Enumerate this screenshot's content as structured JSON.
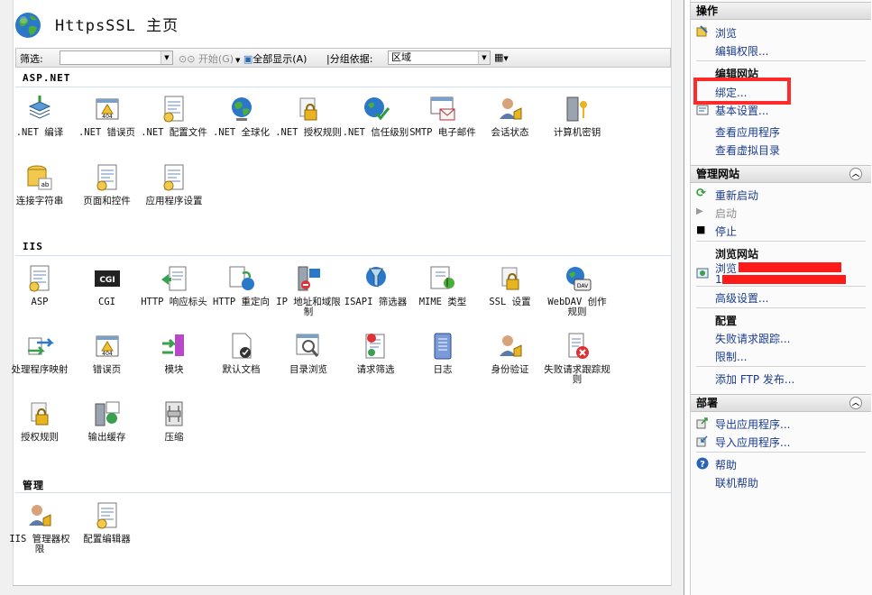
{
  "page": {
    "title": "HttpsSSL 主页"
  },
  "filterbar": {
    "filter_label": "筛选:",
    "start_label": "开始(G)",
    "show_all_label": "全部显示(A)",
    "group_label": "|分组依据:",
    "group_value": "区域"
  },
  "sections": {
    "aspnet": "ASP.NET",
    "iis": "IIS",
    "manage": "管理"
  },
  "features": {
    "aspnet": [
      {
        "label": ".NET 编译",
        "icon": "compile-icon"
      },
      {
        "label": ".NET 错误页",
        "icon": "error-page-icon"
      },
      {
        "label": ".NET 配置文件",
        "icon": "profile-icon"
      },
      {
        "label": ".NET 全球化",
        "icon": "globe-icon"
      },
      {
        "label": ".NET 授权规则",
        "icon": "auth-rules-icon"
      },
      {
        "label": ".NET 信任级别",
        "icon": "trust-level-icon"
      },
      {
        "label": "SMTP 电子邮件",
        "icon": "smtp-icon"
      },
      {
        "label": "会话状态",
        "icon": "session-icon"
      },
      {
        "label": "计算机密钥",
        "icon": "machine-key-icon"
      },
      {
        "label": "连接字符串",
        "icon": "connection-string-icon"
      },
      {
        "label": "页面和控件",
        "icon": "pages-controls-icon"
      },
      {
        "label": "应用程序设置",
        "icon": "app-settings-icon"
      }
    ],
    "iis": [
      {
        "label": "ASP",
        "icon": "asp-icon"
      },
      {
        "label": "CGI",
        "icon": "cgi-icon"
      },
      {
        "label": "HTTP 响应标头",
        "icon": "http-headers-icon"
      },
      {
        "label": "HTTP 重定向",
        "icon": "http-redirect-icon"
      },
      {
        "label": "IP 地址和域限制",
        "icon": "ip-restrict-icon"
      },
      {
        "label": "ISAPI 筛选器",
        "icon": "isapi-icon"
      },
      {
        "label": "MIME 类型",
        "icon": "mime-icon"
      },
      {
        "label": "SSL 设置",
        "icon": "ssl-icon"
      },
      {
        "label": "WebDAV 创作规则",
        "icon": "webdav-icon"
      },
      {
        "label": "处理程序映射",
        "icon": "handler-icon"
      },
      {
        "label": "错误页",
        "icon": "error-page-icon"
      },
      {
        "label": "模块",
        "icon": "modules-icon"
      },
      {
        "label": "默认文档",
        "icon": "default-doc-icon"
      },
      {
        "label": "目录浏览",
        "icon": "dir-browse-icon"
      },
      {
        "label": "请求筛选",
        "icon": "request-filter-icon"
      },
      {
        "label": "日志",
        "icon": "logging-icon"
      },
      {
        "label": "身份验证",
        "icon": "authentication-icon"
      },
      {
        "label": "失败请求跟踪规则",
        "icon": "failed-trace-icon"
      },
      {
        "label": "授权规则",
        "icon": "authorization-icon"
      },
      {
        "label": "输出缓存",
        "icon": "output-cache-icon"
      },
      {
        "label": "压缩",
        "icon": "compression-icon"
      }
    ],
    "manage": [
      {
        "label": "IIS 管理器权限",
        "icon": "iis-manager-perm-icon"
      },
      {
        "label": "配置编辑器",
        "icon": "config-editor-icon"
      }
    ]
  },
  "actions": {
    "header": "操作",
    "browse": "浏览",
    "edit_permissions": "编辑权限...",
    "edit_site": "编辑网站",
    "bindings": "绑定...",
    "basic_settings": "基本设置...",
    "view_apps": "查看应用程序",
    "view_vdirs": "查看虚拟目录",
    "manage_site_header": "管理网站",
    "restart": "重新启动",
    "start": "启动",
    "stop": "停止",
    "browse_site": "浏览网站",
    "browse_item_1": "浏览",
    "browse_item_2": "1",
    "advanced": "高级设置...",
    "config_header": "配置",
    "failed_trace": "失败请求跟踪...",
    "limits": "限制...",
    "add_ftp": "添加 FTP 发布...",
    "deploy_header": "部署",
    "export_app": "导出应用程序...",
    "import_app": "导入应用程序...",
    "help": "帮助",
    "online_help": "联机帮助"
  },
  "colors": {
    "link": "#1a3c8c",
    "highlight": "#ff2a2a"
  }
}
